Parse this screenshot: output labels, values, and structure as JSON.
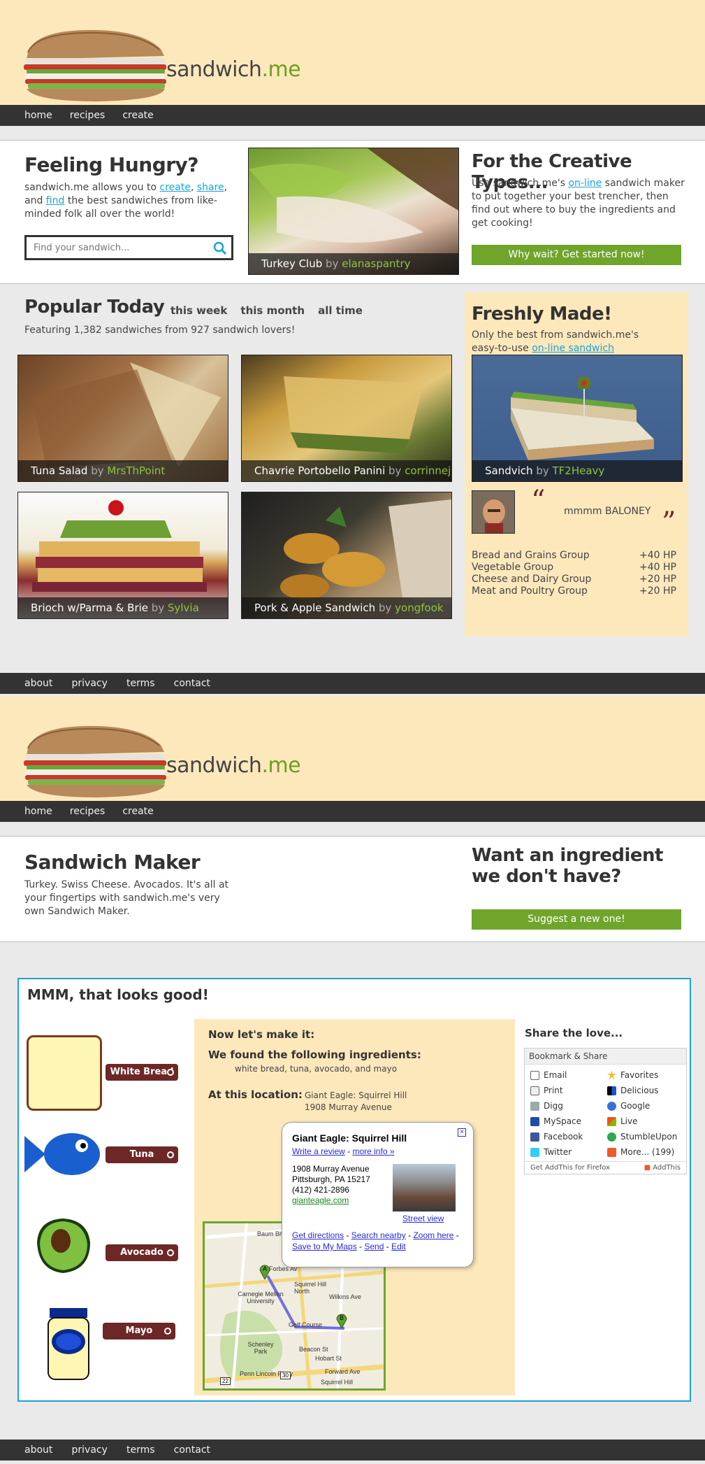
{
  "header": {
    "logo_text": "sandwich",
    "logo_suffix": ".me",
    "nav": [
      "home",
      "recipes",
      "create"
    ]
  },
  "hero": {
    "title": "Feeling Hungry?",
    "intro_pre": "sandwich.me allows you to ",
    "link_create": "create",
    "sep1": ", ",
    "link_share": "share",
    "sep2": ", and",
    "link_find": "find",
    "intro_post": " the best sandwiches from like-minded folk all over the world!",
    "search_placeholder": "Find your sandwich...",
    "featured": {
      "name": "Turkey Club",
      "by": "by",
      "author": "elanaspantry"
    },
    "creative_title": "For the Creative Types...",
    "creative_pre": "Use sandwich.me's ",
    "creative_link": "on-line",
    "creative_post": " sandwich maker to put together your best trencher, then find out where to buy the ingredients and get cooking!",
    "cta": "Why wait? Get started now!"
  },
  "popular": {
    "title": "Popular Today",
    "tabs": [
      "this week",
      "this month",
      "all time"
    ],
    "subtitle": "Featuring 1,382 sandwiches from 927 sandwich lovers!",
    "items": [
      {
        "name": "Tuna Salad",
        "by": "by",
        "author": "MrsThPoint"
      },
      {
        "name": "Chavrie Portobello Panini",
        "by": "by",
        "author": "corrinnej"
      },
      {
        "name": "Brioch w/Parma & Brie",
        "by": "by",
        "author": "Sylvia"
      },
      {
        "name": "Pork & Apple Sandwich",
        "by": "by",
        "author": "yongfook"
      }
    ]
  },
  "fresh": {
    "title": "Freshly Made!",
    "text_pre": "Only the best from sandwich.me's easy-to-use ",
    "text_link": "on-line sandwich maker",
    "text_post": ".",
    "photo": {
      "name": "Sandvich",
      "by": "by",
      "author": "TF2Heavy"
    },
    "quote": "mmmm BALONEY",
    "stats": [
      {
        "group": "Bread and Grains Group",
        "hp": "+40 HP"
      },
      {
        "group": "Vegetable Group",
        "hp": "+40 HP"
      },
      {
        "group": "Cheese and Dairy Group",
        "hp": "+20 HP"
      },
      {
        "group": "Meat and Poultry Group",
        "hp": "+20 HP"
      }
    ]
  },
  "footer": {
    "links": [
      "about",
      "privacy",
      "terms",
      "contact"
    ]
  },
  "maker": {
    "title": "Sandwich Maker",
    "desc": "Turkey. Swiss Cheese. Avocados. It's all at your fingertips with sandwich.me's very own Sandwich Maker.",
    "want_title": "Want an ingredient we don't have?",
    "suggest": "Suggest a new one!",
    "box_title": "MMM, that looks good!",
    "ingredients": [
      "White Bread",
      "Tuna",
      "Avocado",
      "Mayo"
    ],
    "make_title": "Now let's make it:",
    "found_title": "We found the following ingredients:",
    "found_list": "white bread, tuna, avocado, and mayo",
    "location_label": "At this location:",
    "location_name": "Giant Eagle: Squirrel Hill",
    "location_addr": "1908 Murray Avenue",
    "bubble": {
      "title": "Giant Eagle: Squirrel Hill",
      "write_review": "Write a review",
      "dash": " - ",
      "more_info": "more info »",
      "addr1": "1908 Murray Avenue",
      "addr2": "Pittsburgh, PA 15217",
      "phone": "(412) 421-2896",
      "site": "gianteagle.com",
      "street_view": "Street view",
      "get_directions": "Get directions",
      "search_nearby": "Search nearby",
      "zoom_here": "Zoom here",
      "save_maps": "Save to My Maps",
      "send": "Send",
      "edit": "Edit"
    },
    "map_labels": [
      "Baum Blvd",
      "Forbes Av",
      "Carnegie Mellon University",
      "Squirrel Hill North",
      "Wilkins Ave",
      "Golf Course",
      "Schenley Park",
      "Beacon St",
      "Hobart St",
      "Penn Lincoln Pkwy",
      "Forward Ave",
      "Squirrel Hill",
      "22",
      "30",
      "A",
      "B"
    ],
    "share_title": "Share the love...",
    "share_head": "Bookmark & Share",
    "share_items": [
      "Email",
      "Favorites",
      "Print",
      "Delicious",
      "Digg",
      "Google",
      "MySpace",
      "Live",
      "Facebook",
      "StumbleUpon",
      "Twitter",
      "More... (199)"
    ],
    "share_foot_left": "Get AddThis for Firefox",
    "share_foot_right": "AddThis"
  },
  "colors": {
    "cream": "#fde8bc",
    "nav_dark": "#333333",
    "green": "#6fa52a",
    "author_green": "#8ec63f",
    "link_blue": "#1aa3d9",
    "ingredient_tag": "#6d2727",
    "maker_border": "#1ea1d8"
  }
}
